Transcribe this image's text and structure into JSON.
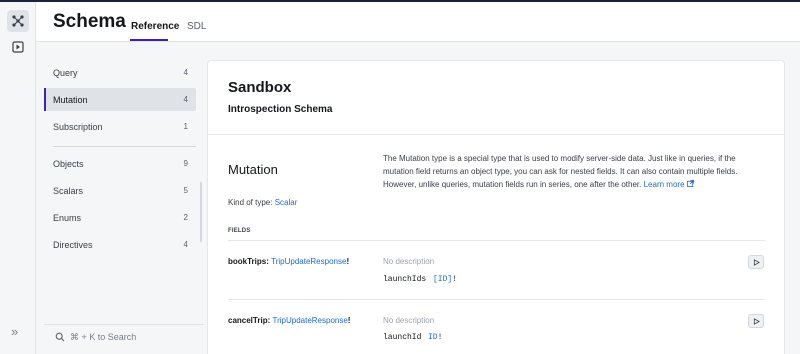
{
  "header": {
    "title": "Schema",
    "tabs": [
      {
        "label": "Reference",
        "active": true
      },
      {
        "label": "SDL",
        "active": false
      }
    ]
  },
  "rail": {
    "icons": [
      "schema-graph-icon",
      "explorer-play-icon"
    ],
    "collapse_label": "»"
  },
  "nav": {
    "groups": [
      [
        {
          "label": "Query",
          "count": "4"
        },
        {
          "label": "Mutation",
          "count": "4",
          "active": true
        },
        {
          "label": "Subscription",
          "count": "1"
        }
      ],
      [
        {
          "label": "Objects",
          "count": "9"
        },
        {
          "label": "Scalars",
          "count": "5"
        },
        {
          "label": "Enums",
          "count": "2"
        },
        {
          "label": "Directives",
          "count": "4"
        }
      ]
    ],
    "search_placeholder": "⌘ + K to Search"
  },
  "card": {
    "title": "Sandbox",
    "subtitle": "Introspection Schema",
    "type_name": "Mutation",
    "description": "The Mutation type is a special type that is used to modify server-side data. Just like in queries, if the mutation field returns an object type, you can ask for nested fields. It can also contain multiple fields. However, unlike queries, mutation fields run in series, one after the other.",
    "learn_more": "Learn more",
    "kind_label": "Kind of type:",
    "kind_value": "Scalar",
    "fields_label": "FIELDS",
    "fields": [
      {
        "name": "bookTrips:",
        "type": "TripUpdateResponse",
        "bang": "!",
        "description": "No description",
        "arg_name": "launchIds",
        "arg_type": "[ID]",
        "arg_bang": "!"
      },
      {
        "name": "cancelTrip:",
        "type": "TripUpdateResponse",
        "bang": "!",
        "description": "No description",
        "arg_name": "launchId",
        "arg_type": "ID",
        "arg_bang": "!"
      }
    ]
  },
  "colors": {
    "accent": "#3f20ba",
    "link": "#1f6ad0",
    "topbar": "#1b2240"
  }
}
